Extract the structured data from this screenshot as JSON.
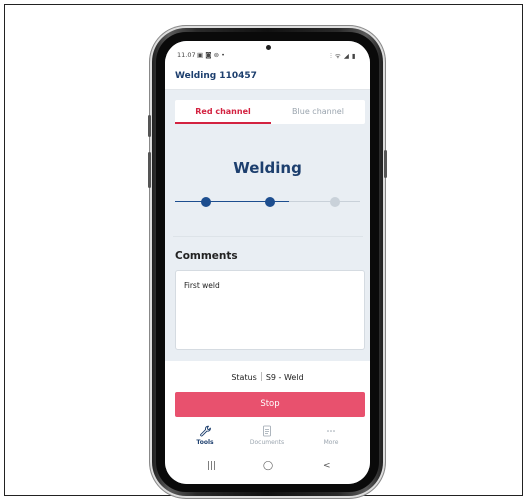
{
  "status_bar": {
    "time": "11.07",
    "notif_icons": "▣ ◙ ⊚ •",
    "system_icons": "⫶ ᯤ ◢ ▮"
  },
  "app_bar": {
    "title": "Welding 110457"
  },
  "tabs": [
    {
      "label": "Red channel",
      "active": true
    },
    {
      "label": "Blue channel",
      "active": false
    }
  ],
  "heading": "Welding",
  "stepper": {
    "steps": 3,
    "completed": 2,
    "active_color": "#1d4e8f",
    "inactive_color": "#c9d1d9"
  },
  "comments": {
    "title": "Comments",
    "text": "First weld"
  },
  "status": {
    "label": "Status",
    "value": "S9 - Weld"
  },
  "stop_button": {
    "label": "Stop",
    "color": "#e8516e"
  },
  "bottom_nav": [
    {
      "label": "Tools",
      "icon": "wrench-icon",
      "active": true
    },
    {
      "label": "Documents",
      "icon": "document-icon",
      "active": false
    },
    {
      "label": "More",
      "icon": "more-icon",
      "active": false
    }
  ],
  "system_nav": {
    "recents": "|||",
    "home": "◯",
    "back": "<"
  },
  "colors": {
    "brand_blue": "#1d3f6e",
    "accent_red": "#d32240",
    "screen_bg": "#e9eef3"
  }
}
